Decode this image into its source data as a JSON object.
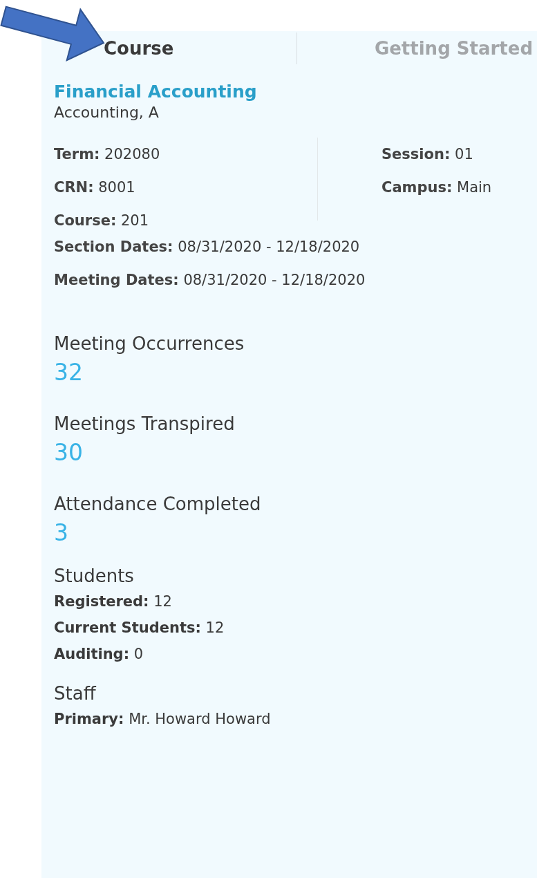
{
  "tabs": [
    {
      "label": "Course",
      "selected": true
    },
    {
      "label": "Getting Started",
      "selected": false
    }
  ],
  "course": {
    "title": "Financial Accounting",
    "subtitle": "Accounting, A"
  },
  "details_left": [
    "**Term:** 202080",
    "**CRN:** 8001",
    "**Course:** 201"
  ],
  "details_right": [
    "**Session:** 01",
    "**Campus:** Main"
  ],
  "dates": [
    "**Section Dates:** 08/31/2020 - 12/18/2020",
    "**Meeting Dates:** 08/31/2020 - 12/18/2020"
  ],
  "stats": [
    {
      "label": "Meeting Occurrences",
      "value": "32"
    },
    {
      "label": "Meetings Transpired",
      "value": "30"
    },
    {
      "label": "Attendance Completed",
      "value": "3"
    }
  ],
  "groups": [
    {
      "heading": "Students",
      "lines": [
        "**Registered:** 12",
        "**Current Students:** 12",
        "**Auditing:** 0"
      ]
    },
    {
      "heading": "Staff",
      "lines": [
        "**Primary:** Mr. Howard Howard"
      ]
    }
  ]
}
